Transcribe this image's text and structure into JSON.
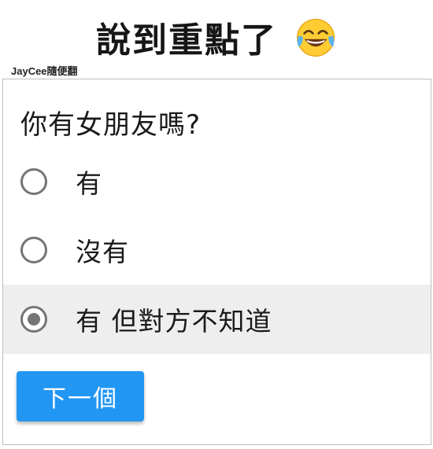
{
  "caption": {
    "text": "說到重點了",
    "emoji_icon": "face-with-tears-of-joy-icon"
  },
  "watermark": "JayCee隨便翻",
  "form": {
    "question": "你有女朋友嗎?",
    "options": [
      {
        "label": "有",
        "selected": false
      },
      {
        "label": "沒有",
        "selected": false
      },
      {
        "label": "有 但對方不知道",
        "selected": true
      }
    ],
    "next_button_label": "下一個"
  },
  "colors": {
    "accent": "#2196f3",
    "radio": "#757575",
    "selected_row": "#eeeeee",
    "card_border": "#bdbdbd"
  }
}
